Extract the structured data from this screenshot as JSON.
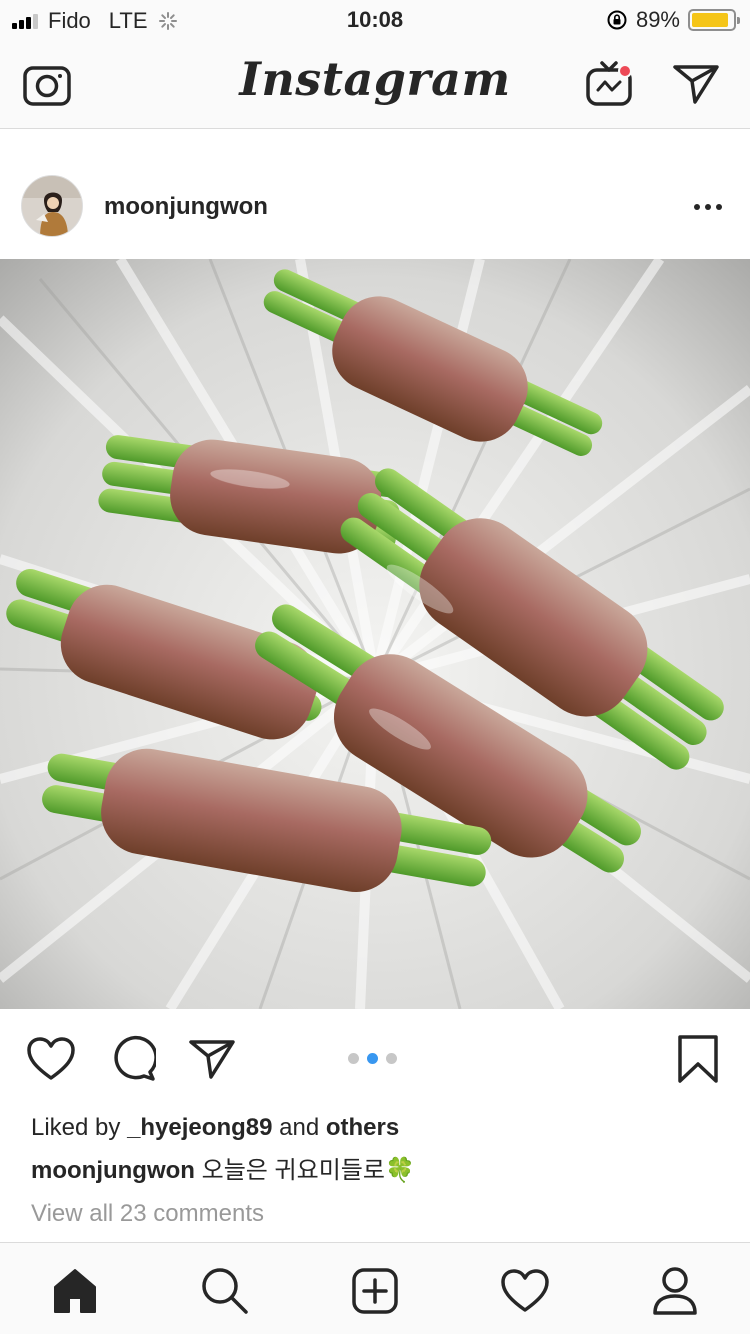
{
  "status_bar": {
    "carrier": "Fido",
    "network": "LTE",
    "time": "10:08",
    "battery": "89%",
    "battery_level": 0.89
  },
  "nav": {
    "logo": "Instagram",
    "icons": [
      "camera-icon",
      "igtv-icon",
      "direct-message-icon"
    ]
  },
  "post": {
    "username": "moonjungwon",
    "carousel_index": 2,
    "carousel_count": 3,
    "liked_by_prefix": "Liked by",
    "liked_by_user": "_hyejeong89",
    "liked_by_and": "and",
    "liked_by_others": "others",
    "caption_user": "moonjungwon",
    "caption_text": "오늘은 귀요미들로",
    "caption_emoji": "🍀",
    "view_comments": "View all 23 comments"
  },
  "tab_bar": {
    "items": [
      "home-icon",
      "search-icon",
      "new-post-icon",
      "activity-icon",
      "profile-icon"
    ]
  },
  "colors": {
    "accent": "#3897f0",
    "notification": "#ed4956",
    "battery": "#f5c518",
    "text": "#262626",
    "muted": "#999999"
  }
}
